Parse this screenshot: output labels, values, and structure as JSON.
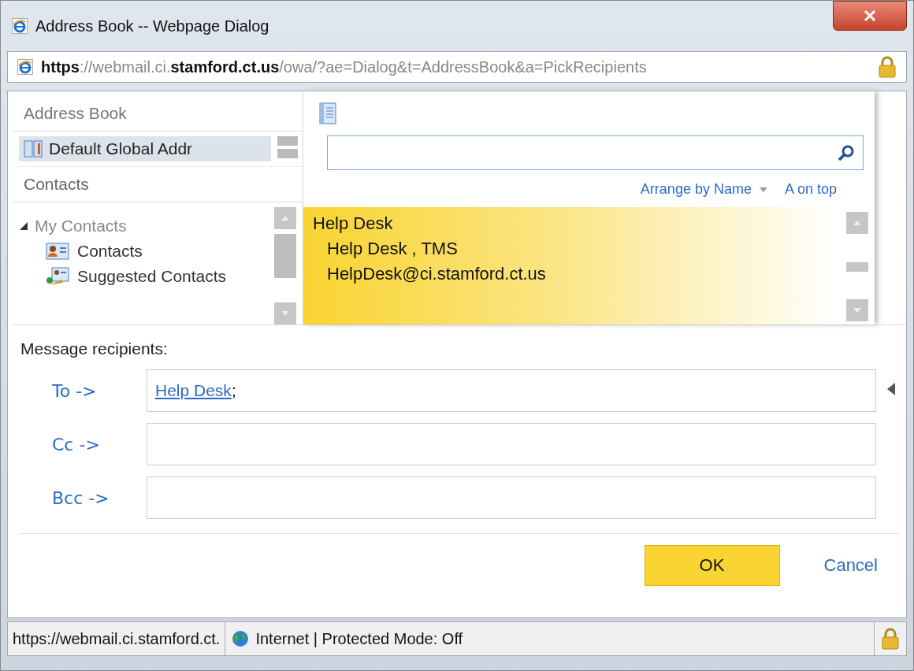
{
  "window": {
    "title": "Address Book -- Webpage Dialog",
    "url": "**https**://webmail.ci.**stamford.ct.us**/owa/?ae=Dialog&t=AddressBook&a=PickRecipients"
  },
  "address_book": {
    "title": "Address Book",
    "items": [
      {
        "label": "Default Global Addr",
        "selected": true
      }
    ]
  },
  "contacts": {
    "title": "Contacts",
    "tree": [
      {
        "label": "My Contacts",
        "expanded": true,
        "children": [
          {
            "label": "Contacts",
            "kind": "contacts"
          },
          {
            "label": "Suggested Contacts",
            "kind": "suggested"
          }
        ]
      }
    ]
  },
  "arrange": {
    "sort": "Arrange by Name",
    "order": "A on top"
  },
  "results": [
    {
      "group": "Help Desk",
      "name": "Help Desk , TMS",
      "email": "HelpDesk@ci.stamford.ct.us",
      "selected": true
    }
  ],
  "recipients": {
    "label": "Message recipients:",
    "fields": [
      {
        "label": "To ->",
        "entries": [
          {
            "name": "Help Desk",
            "separator": ";"
          }
        ]
      },
      {
        "label": "Cc ->"
      },
      {
        "label": "Bcc ->"
      }
    ]
  },
  "buttons": [
    {
      "label": "OK",
      "kind": "primary"
    },
    {
      "label": "Cancel",
      "kind": "link"
    }
  ],
  "status_bar": {
    "url": "https://webmail.ci.stamford.ct.",
    "zone": "Internet | Protected Mode: Off"
  }
}
